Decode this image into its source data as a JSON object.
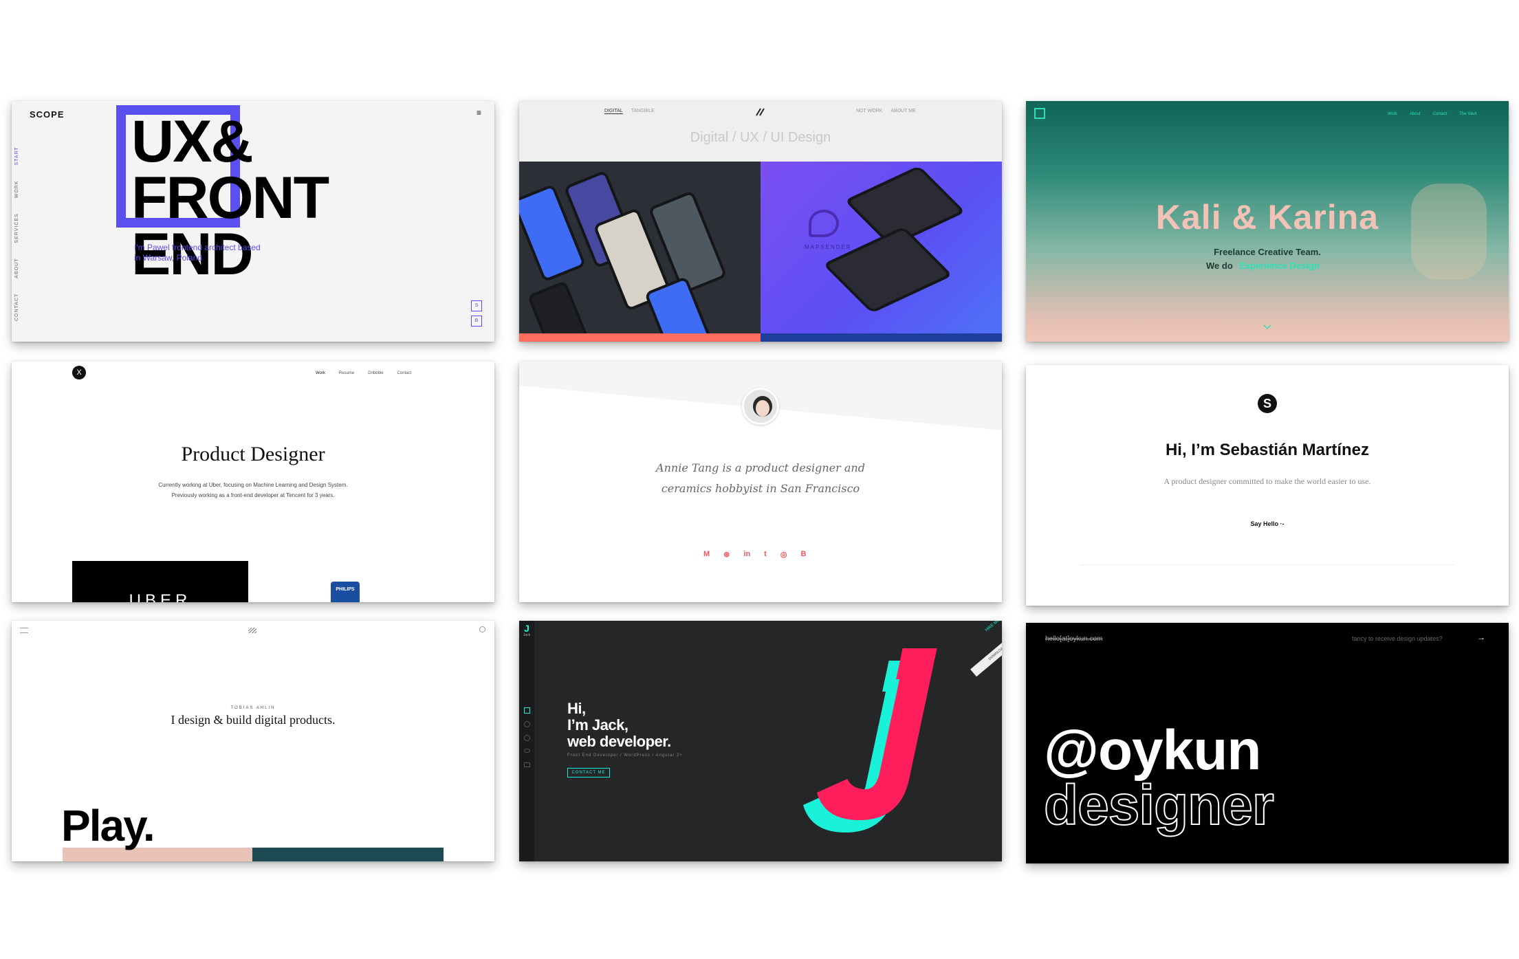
{
  "cards": {
    "scope": {
      "logo": "SCOPE",
      "headline": [
        "UX&",
        "FRONT",
        "END"
      ],
      "intro": [
        "I'm Pawel frontend architect based",
        "in Warsaw, Poland"
      ],
      "side_nav": [
        "START",
        "WORK",
        "SERVICES",
        "ABOUT",
        "CONTACT"
      ],
      "social": [
        "S",
        "B"
      ],
      "menu_glyph": "≡",
      "accent": "#5a4ff0"
    },
    "digital": {
      "tabs": [
        "DIGITAL",
        "TANGIBLE"
      ],
      "nav": [
        "NOT WORK",
        "ABOUT ME"
      ],
      "heading": "Digital / UX / UI Design",
      "brand": "MAPSENDER"
    },
    "kali": {
      "title": "Kali & Karina",
      "nav": [
        "Work",
        "About",
        "Contact",
        "The Vault"
      ],
      "tagline": "Freelance Creative Team.",
      "we_do": "We do",
      "highlight": "Experience Design",
      "accent": "#2de0b5",
      "title_color": "#f2c2b6"
    },
    "product": {
      "nav": [
        "Work",
        "Resume",
        "Dribbble",
        "Contact"
      ],
      "title": "Product Designer",
      "lines": [
        "Currently working at Uber, focusing on Machine Learning and Design System.",
        "Previously working as a front-end developer at Tencent for 3 years."
      ],
      "logo1": "UBER",
      "logo2": "PHILIPS"
    },
    "annie": {
      "lines": [
        "Annie Tang is a product designer and",
        "ceramics hobbyist in San Francisco"
      ],
      "social": [
        "M",
        "⊛",
        "in",
        "t",
        "◎",
        "B"
      ],
      "accent": "#f0555d"
    },
    "sebastian": {
      "title": "Hi, I’m Sebastián Martínez",
      "subtitle": "A product designer committed to make the world easier to use.",
      "cta": "Say Hello ·-"
    },
    "tobias": {
      "name": "TOBIAS AHLIN",
      "line": "I design & build digital products.",
      "play": "Play."
    },
    "jack": {
      "lines": [
        "Hi,",
        "I’m Jack,",
        "web developer."
      ],
      "sub": "Front End Developer / WordPress / Angular 2+",
      "cta": "CONTACT ME",
      "ribbon": [
        "HIRE ME",
        "DOWNLOAD"
      ],
      "logo_letter": "J",
      "logo_name": "Jack",
      "accent1": "#ff1e5c",
      "accent2": "#19f2d8"
    },
    "oykun": {
      "email": "hello[at]oykun.com",
      "prompt": "fancy to receive design updates?",
      "arrow": "→",
      "handle": "@oykun",
      "role": "designer"
    }
  }
}
